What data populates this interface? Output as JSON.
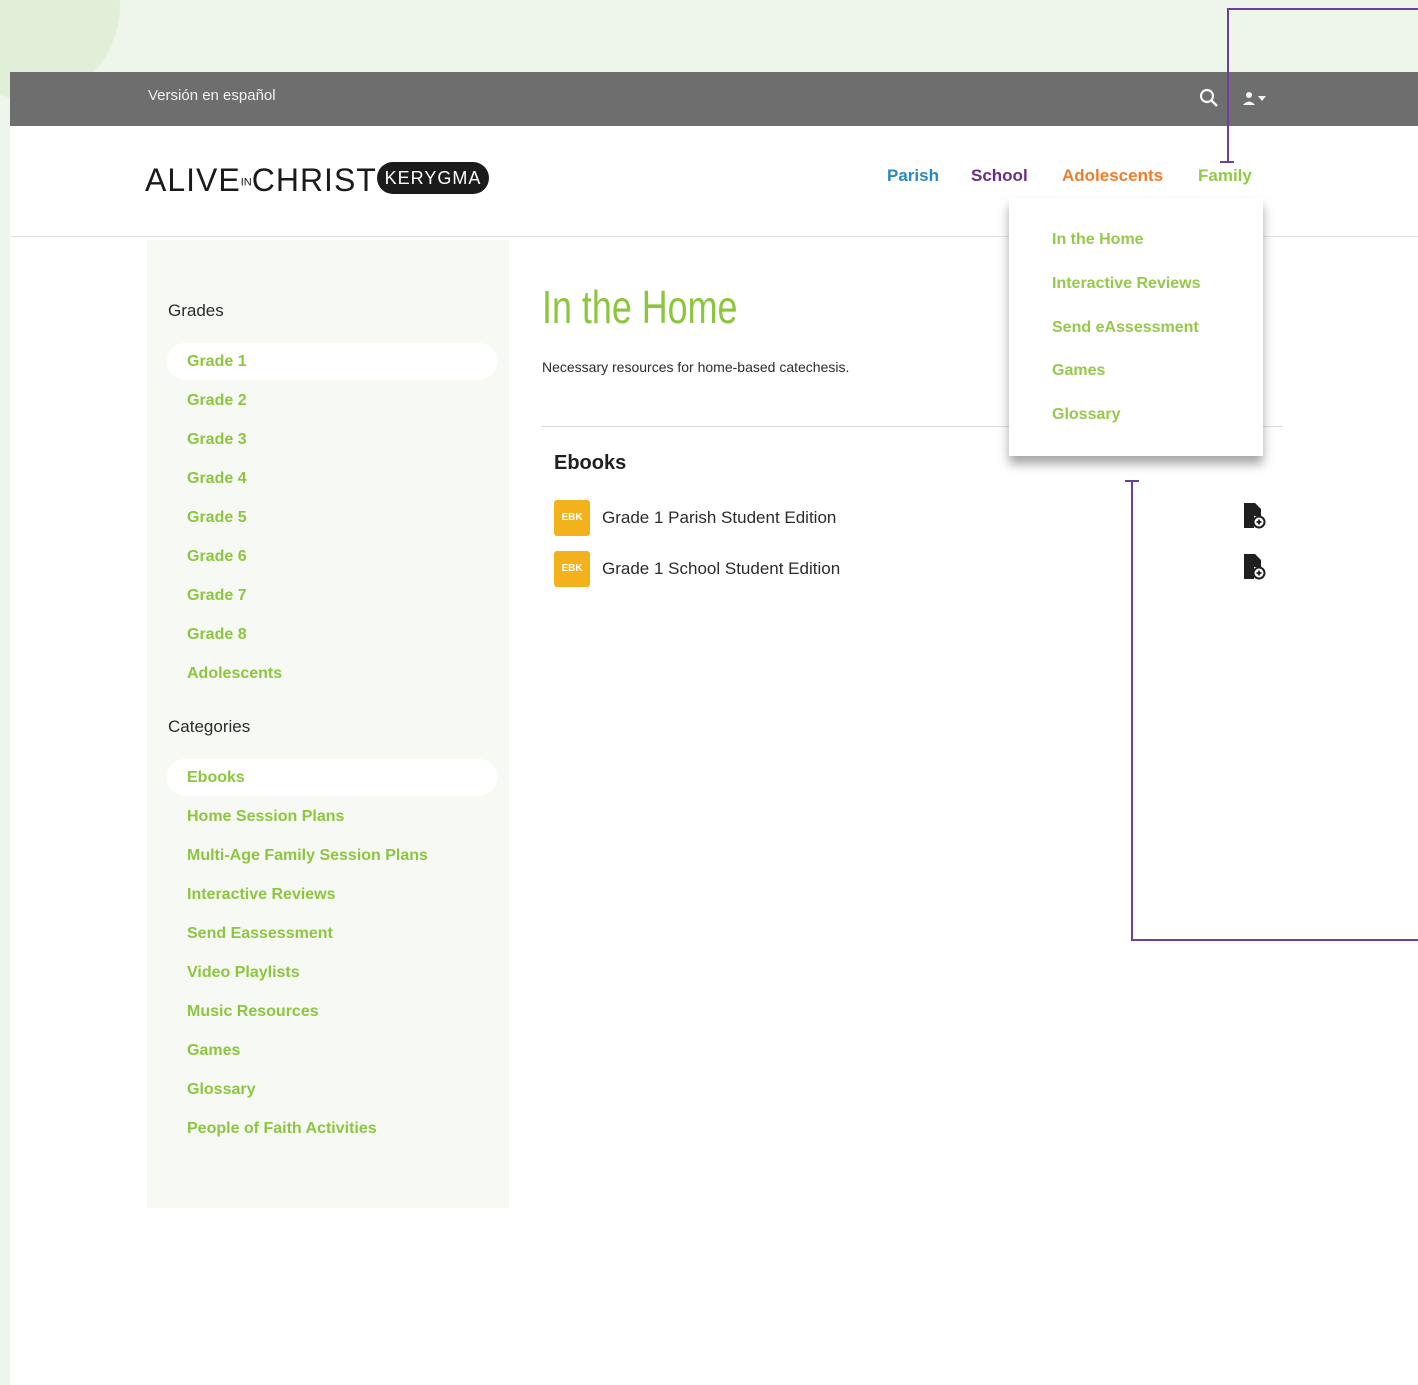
{
  "topbar": {
    "language_link": "Versión en español",
    "search_icon": "search-icon",
    "user_icon": "user-icon"
  },
  "brand": {
    "logo_part1": "ALIVE",
    "logo_small": "IN",
    "logo_part2": "CHRIST",
    "badge": "KERYGMA"
  },
  "nav": {
    "parish": "Parish",
    "school": "School",
    "adolescents": "Adolescents",
    "family": "Family"
  },
  "colors": {
    "parish": "#2b87c7",
    "school": "#6b2b86",
    "adolescents": "#ef7d2a",
    "family": "#95c94a",
    "accent_green": "#8cc63f",
    "ebook_badge": "#f3b21c",
    "callout": "#6b3fa0"
  },
  "family_menu": {
    "items": [
      "In the Home",
      "Interactive Reviews",
      "Send eAssessment",
      "Games",
      "Glossary"
    ]
  },
  "sidebar": {
    "grades_heading": "Grades",
    "grades": [
      "Grade 1",
      "Grade 2",
      "Grade 3",
      "Grade 4",
      "Grade 5",
      "Grade 6",
      "Grade 7",
      "Grade 8",
      "Adolescents"
    ],
    "categories_heading": "Categories",
    "categories": [
      "Ebooks",
      "Home Session Plans",
      "Multi-Age Family Session Plans",
      "Interactive Reviews",
      "Send Eassessment",
      "Video Playlists",
      "Music Resources",
      "Games",
      "Glossary",
      "People of Faith Activities"
    ]
  },
  "main": {
    "title": "In the Home",
    "subtitle": "Necessary resources for home-based catechesis.",
    "section_title": "Ebooks",
    "ebooks": [
      {
        "badge": "EBK",
        "title": "Grade 1 Parish Student Edition",
        "icon": "file-download-icon"
      },
      {
        "badge": "EBK",
        "title": "Grade 1 School Student Edition",
        "icon": "file-download-icon"
      }
    ]
  }
}
